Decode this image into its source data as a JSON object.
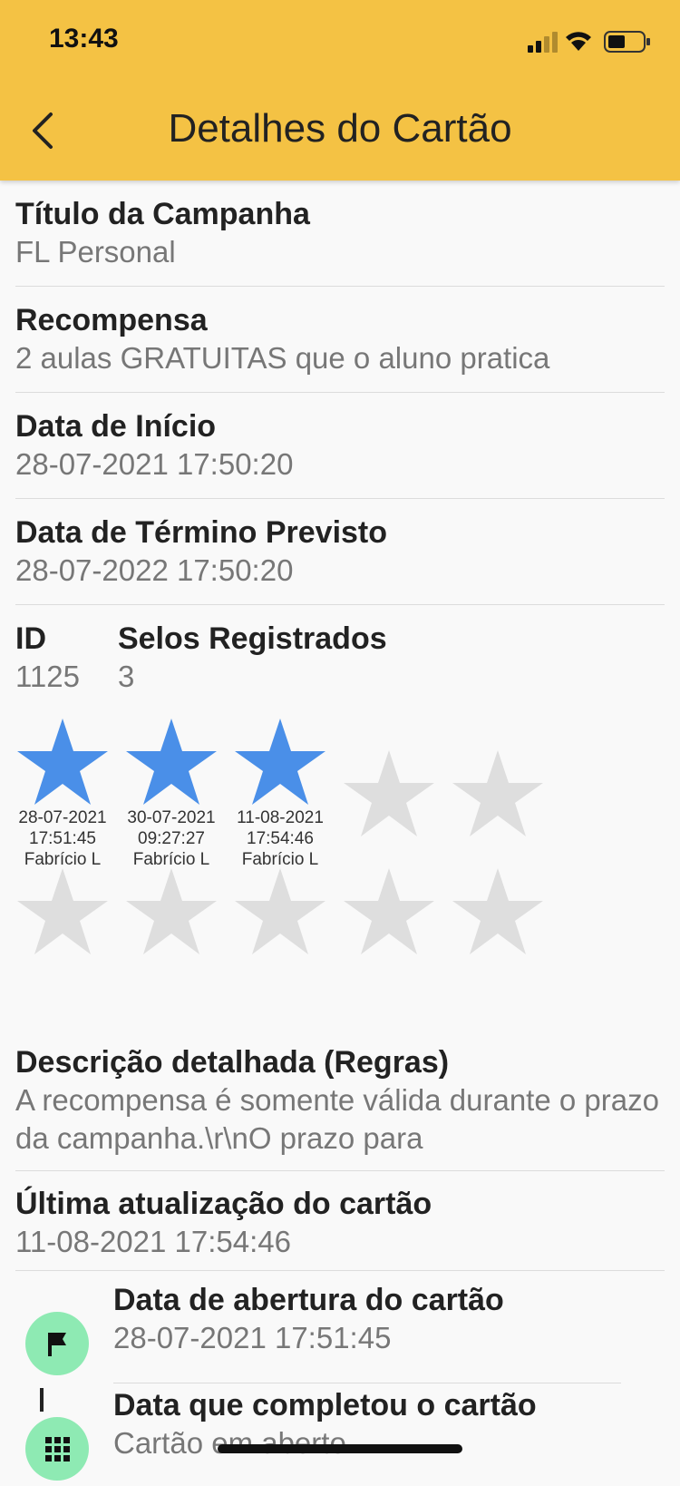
{
  "status_bar": {
    "time": "13:43"
  },
  "header": {
    "title": "Detalhes do Cartão"
  },
  "fields": {
    "campaign_title": {
      "label": "Título da Campanha",
      "value": "FL Personal"
    },
    "reward": {
      "label": "Recompensa",
      "value": "2 aulas GRATUITAS que o aluno pratica"
    },
    "start_date": {
      "label": "Data de Início",
      "value": "28-07-2021 17:50:20"
    },
    "end_date": {
      "label": "Data de Término Previsto",
      "value": "28-07-2022 17:50:20"
    },
    "id": {
      "label": "ID",
      "value": "1125"
    },
    "stamps_count": {
      "label": "Selos Registrados",
      "value": "3"
    }
  },
  "stamps": {
    "filled_color": "#4a8fe8",
    "empty_color": "#dedede",
    "total": 10,
    "filled": 3,
    "registered": [
      {
        "date": "28-07-2021",
        "time": "17:51:45",
        "user": "Fabrício L"
      },
      {
        "date": "30-07-2021",
        "time": "09:27:27",
        "user": "Fabrício L"
      },
      {
        "date": "11-08-2021",
        "time": "17:54:46",
        "user": "Fabrício L"
      }
    ]
  },
  "rules": {
    "label": "Descrição detalhada (Regras)",
    "value": "A recompensa é somente válida durante o prazo da campanha.\\r\\nO prazo para"
  },
  "last_update": {
    "label": "Última atualização do cartão",
    "value": "11-08-2021 17:54:46"
  },
  "timeline": [
    {
      "icon": "flag-icon",
      "label": "Data de abertura do cartão",
      "value": "28-07-2021 17:51:45"
    },
    {
      "icon": "grid-icon",
      "label": "Data que completou o cartão",
      "value": "Cartão em aberto"
    }
  ]
}
